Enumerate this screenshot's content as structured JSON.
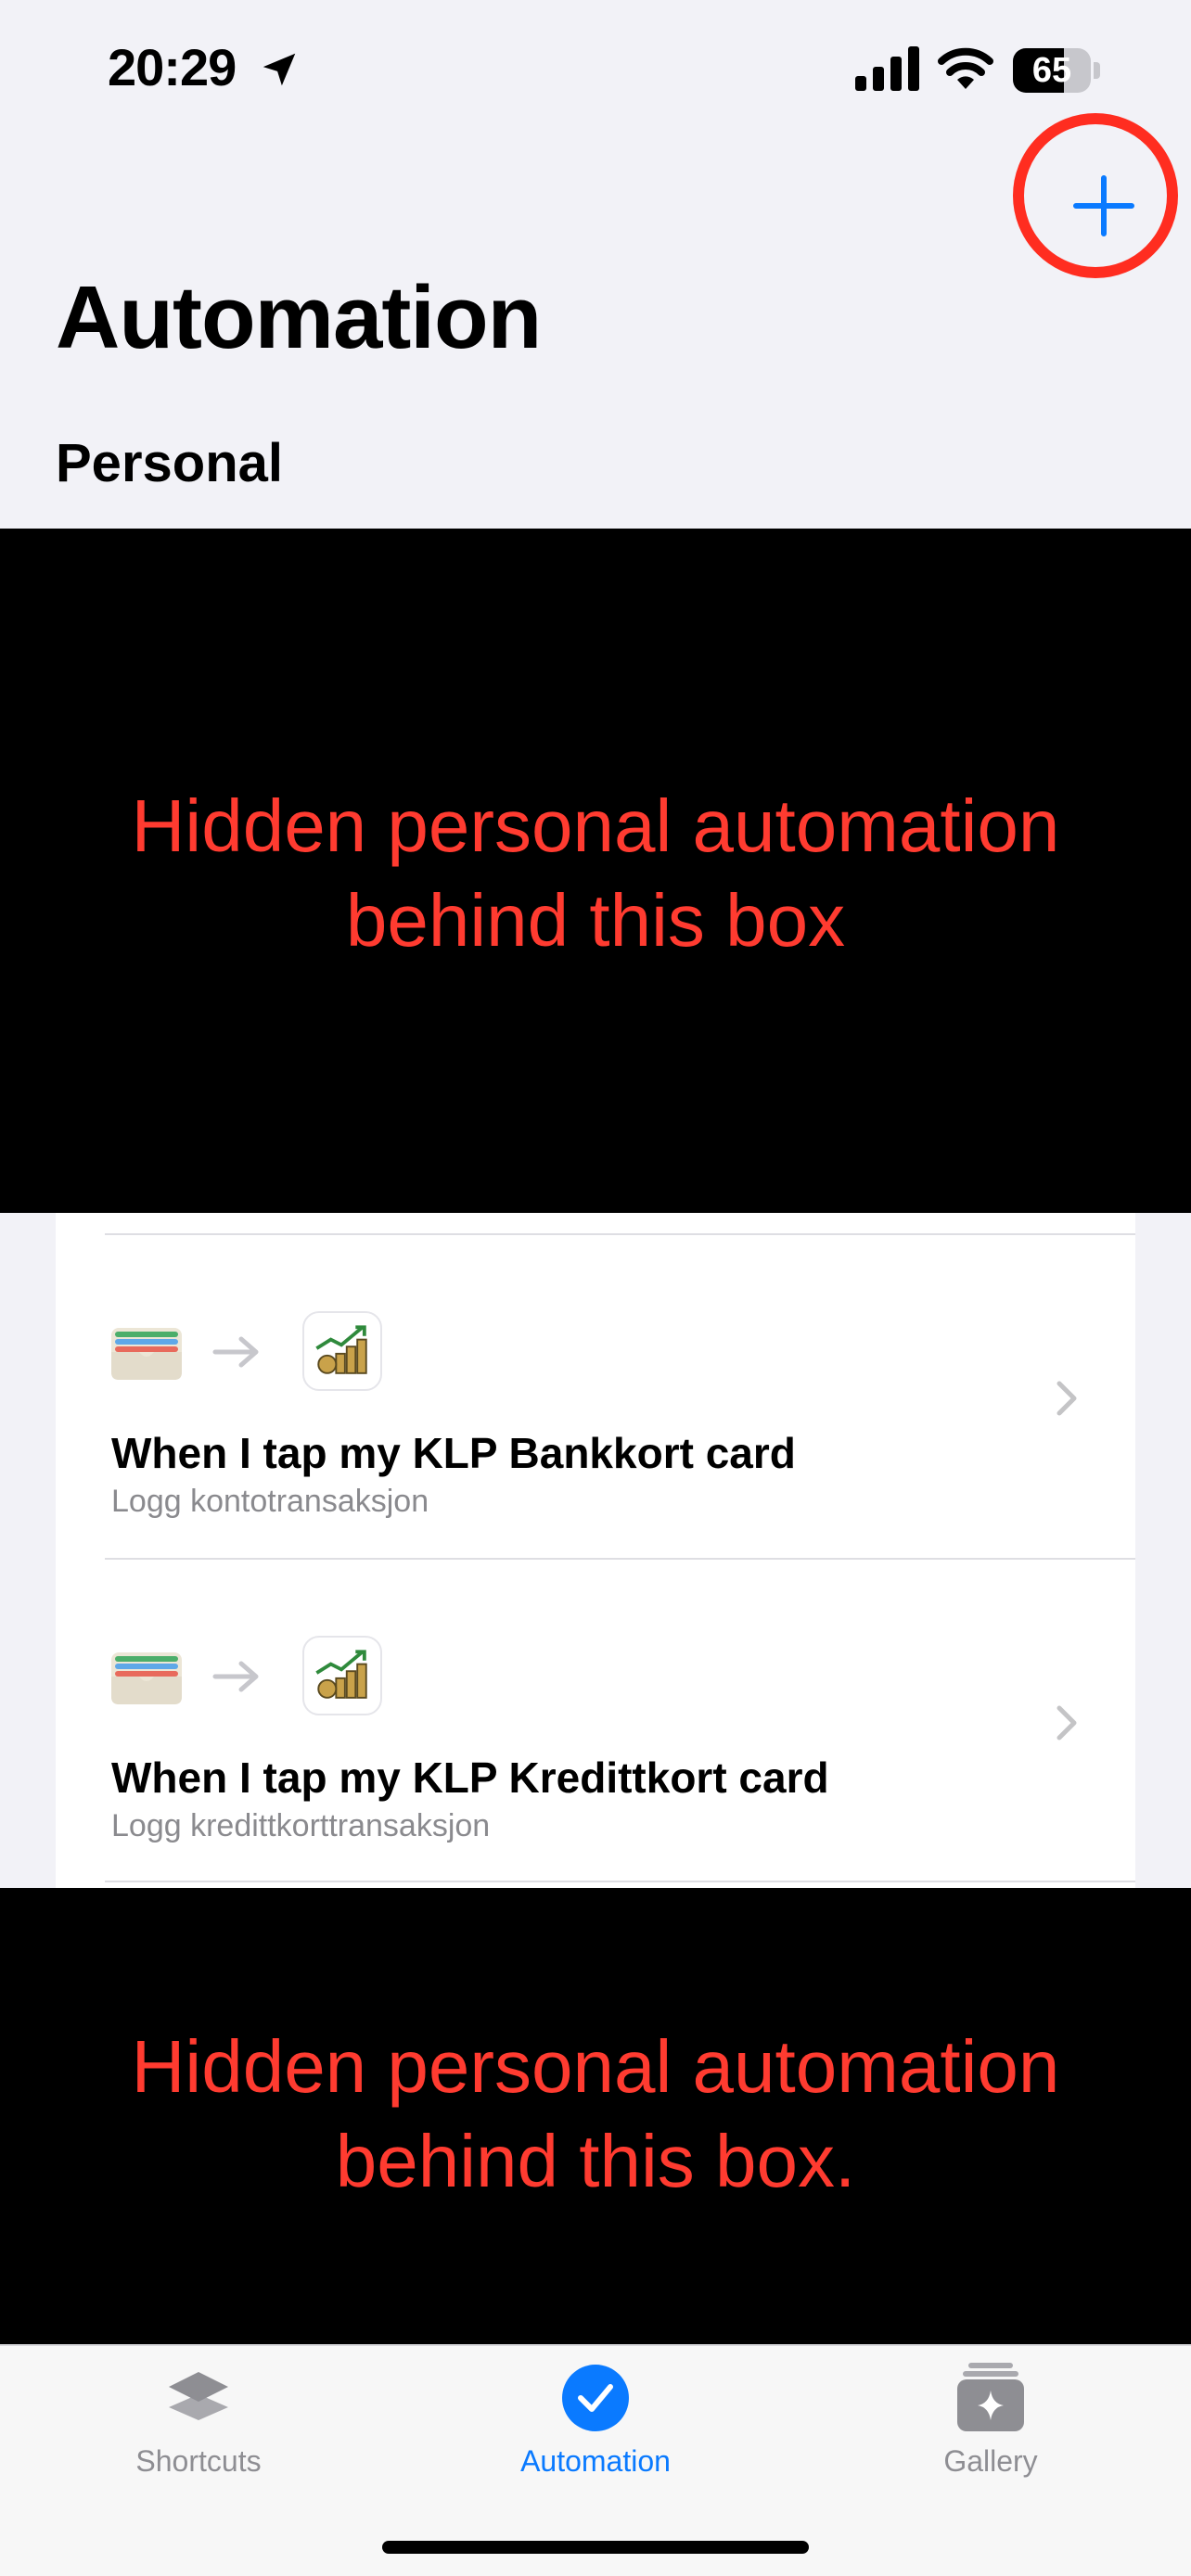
{
  "status_bar": {
    "time": "20:29",
    "battery_percent": 65
  },
  "header": {
    "title": "Automation",
    "section": "Personal"
  },
  "redactions": [
    {
      "lines": [
        "Hidden personal automation",
        "behind this box"
      ]
    },
    {
      "lines": [
        "Hidden personal automation",
        "behind this box."
      ]
    }
  ],
  "automations": [
    {
      "title": "When I tap my KLP Bankkort card",
      "subtitle": "Logg kontotransaksjon"
    },
    {
      "title": "When I tap my KLP Kredittkort card",
      "subtitle": "Logg kredittkorttransaksjon"
    }
  ],
  "tabs": [
    {
      "label": "Shortcuts",
      "icon": "layers-icon",
      "active": false
    },
    {
      "label": "Automation",
      "icon": "checkmark-circle-icon",
      "active": true
    },
    {
      "label": "Gallery",
      "icon": "sparkle-stack-icon",
      "active": false
    }
  ],
  "colors": {
    "accent": "#0a7aff",
    "annotation": "#ff2d20",
    "redaction_text": "#ff3b30"
  }
}
